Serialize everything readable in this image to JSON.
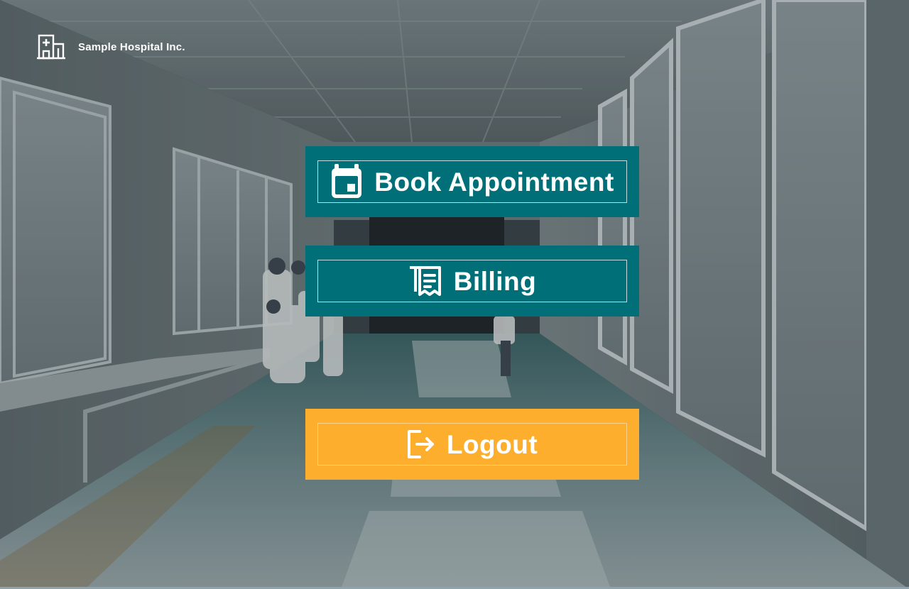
{
  "app": {
    "brand_name": "Sample Hospital Inc.",
    "brand_icon": "hospital-building-icon"
  },
  "menu": {
    "book": {
      "label": "Book Appointment",
      "icon": "calendar-icon",
      "color": "#016f78"
    },
    "billing": {
      "label": "Billing",
      "icon": "receipt-icon",
      "color": "#016f78"
    },
    "logout": {
      "label": "Logout",
      "icon": "logout-icon",
      "color": "#fdae2c"
    }
  },
  "background": {
    "scene": "hospital-corridor-photo"
  }
}
